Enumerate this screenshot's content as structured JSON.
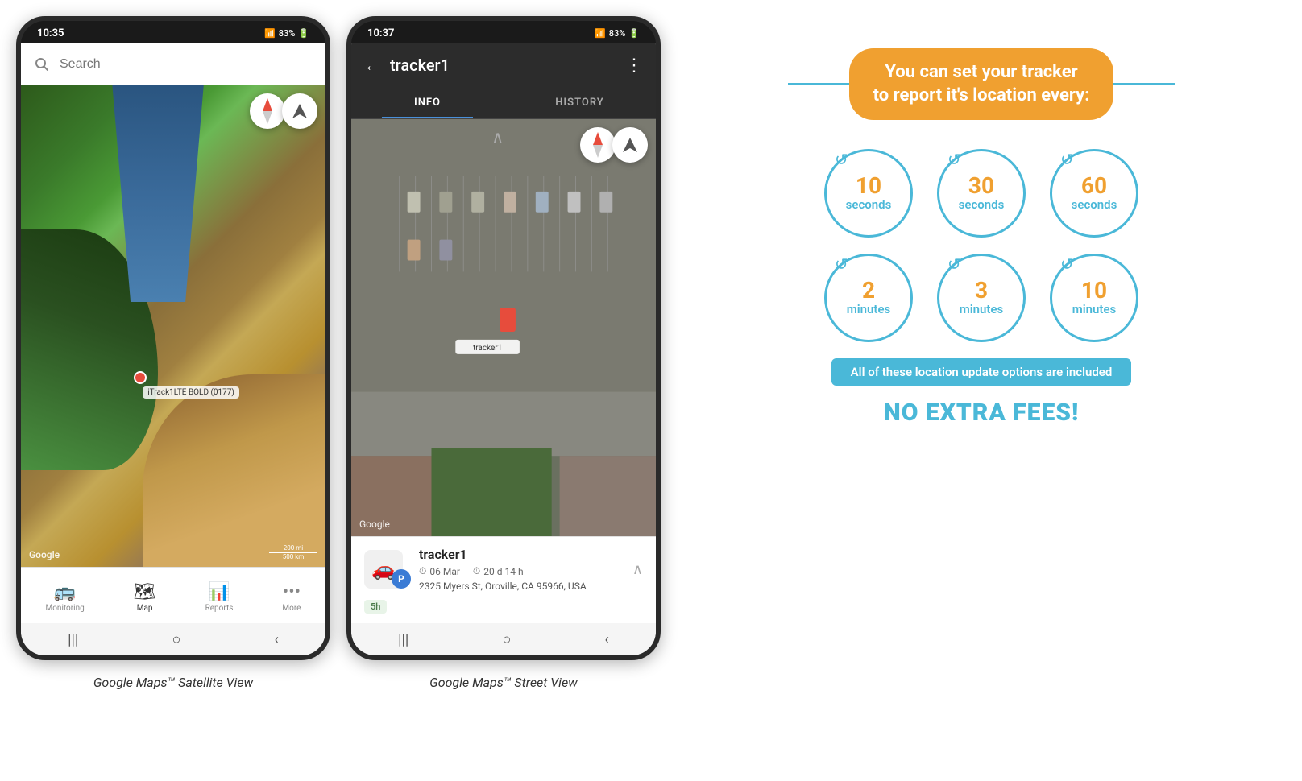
{
  "phone1": {
    "status_time": "10:35",
    "status_icons": "▲ .all 83% ▓",
    "search_placeholder": "Search",
    "map_label": "iTrack1LTE BOLD (0177)",
    "google_watermark": "Google",
    "scale_text1": "200 mi",
    "scale_text2": "500 km",
    "nav_items": [
      {
        "label": "Monitoring",
        "icon": "🚌",
        "active": false
      },
      {
        "label": "Map",
        "icon": "🗺",
        "active": true
      },
      {
        "label": "Reports",
        "icon": "📊",
        "active": false
      },
      {
        "label": "More",
        "icon": "•••",
        "active": false
      }
    ],
    "caption": "Google Maps™ Satellite View"
  },
  "phone2": {
    "status_time": "10:37",
    "status_icons": "▲ .all 83% ▓",
    "back_icon": "←",
    "tracker_title": "tracker1",
    "more_icon": "⋮",
    "tabs": [
      {
        "label": "INFO",
        "active": true
      },
      {
        "label": "HISTORY",
        "active": false
      }
    ],
    "google_watermark": "Google",
    "tracker_label": "tracker1",
    "info": {
      "tracker_name": "tracker1",
      "date": "06 Mar",
      "duration": "20 d 14 h",
      "time_badge": "5h",
      "address": "2325 Myers St, Oroville, CA 95966, USA"
    },
    "caption": "Google Maps™ Street View"
  },
  "infographic": {
    "title_line1": "You can set your tracker",
    "title_line2": "to report it's location every:",
    "circles_row1": [
      {
        "number": "10",
        "unit": "seconds"
      },
      {
        "number": "30",
        "unit": "seconds"
      },
      {
        "number": "60",
        "unit": "seconds"
      }
    ],
    "circles_row2": [
      {
        "number": "2",
        "unit": "minutes"
      },
      {
        "number": "3",
        "unit": "minutes"
      },
      {
        "number": "10",
        "unit": "minutes"
      }
    ],
    "included_text": "All of these location update options are included",
    "no_fees_text": "NO EXTRA FEES!"
  }
}
